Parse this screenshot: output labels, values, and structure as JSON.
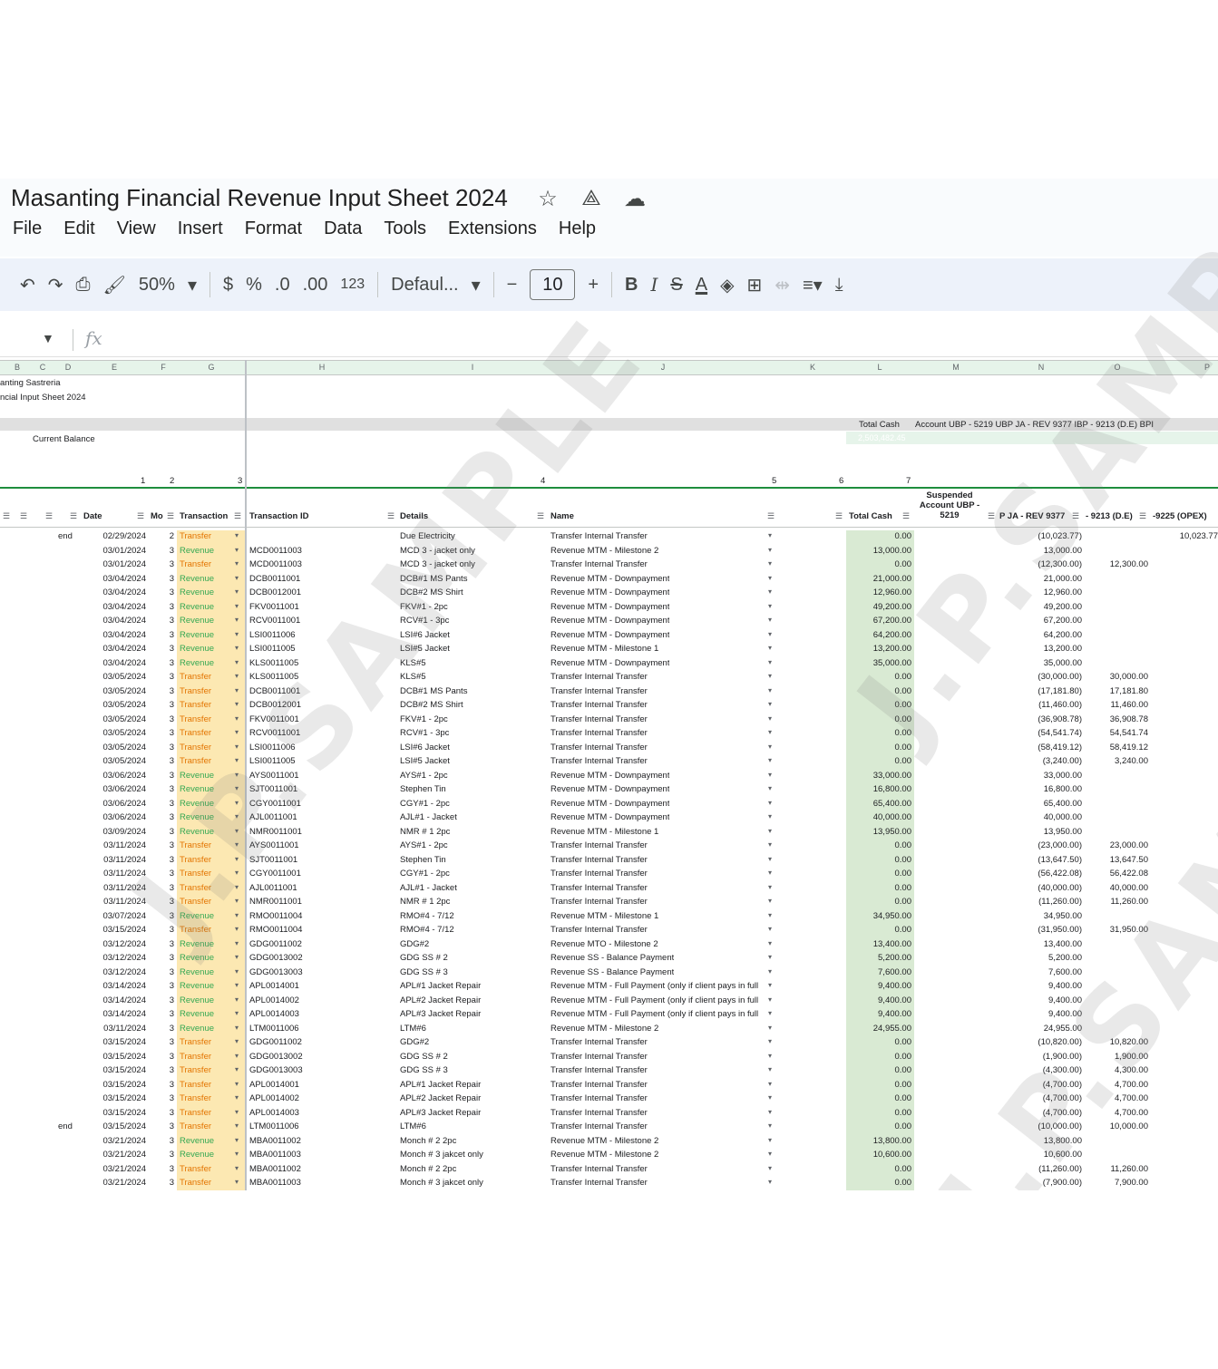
{
  "doc": {
    "title": "Masanting Financial Revenue Input Sheet 2024",
    "menu": [
      "File",
      "Edit",
      "View",
      "Insert",
      "Format",
      "Data",
      "Tools",
      "Extensions",
      "Help"
    ]
  },
  "toolbar": {
    "zoom": "50%",
    "currency": "$",
    "percent": "%",
    "dec_decrease": ".0",
    "dec_increase": ".00",
    "number_format": "123",
    "font": "Defaul...",
    "font_size": "10",
    "minus": "−",
    "plus": "+",
    "bold": "B",
    "italic": "I"
  },
  "formula": {
    "fx": "fx"
  },
  "columns": [
    "B",
    "C",
    "D",
    "E",
    "F",
    "G",
    "H",
    "I",
    "J",
    "K",
    "L",
    "M",
    "N",
    "O",
    "P"
  ],
  "sheet_header": {
    "line1": "anting Sastreria",
    "line2": "ncial Input Sheet 2024",
    "current_balance_label": "Current Balance",
    "total_cash_label": "Total Cash",
    "accounts_line": "Account UBP - 5219  UBP JA - REV 9377 IBP - 9213 (D.E)  BPI",
    "balance_value": "2,503,482.45",
    "group_numbers": [
      "1",
      "2",
      "3",
      "4",
      "5",
      "6",
      "7"
    ]
  },
  "headers": {
    "date": "Date",
    "mo": "Mo",
    "transaction": "Transaction",
    "transaction_id": "Transaction ID",
    "details": "Details",
    "name": "Name",
    "total_cash": "Total Cash",
    "suspended": "Suspended Account UBP - 5219",
    "pja": "P JA - REV 9377",
    "de": "- 9213 (D.E)",
    "opex": "-9225 (OPEX)"
  },
  "rows": [
    {
      "flag": "end",
      "date": "02/29/2024",
      "mo": "2",
      "type": "Transfer",
      "tid": "",
      "details": "Due Electricity",
      "name": "Transfer Internal Transfer",
      "total": "0.00",
      "n": "(10,023.77)",
      "o": "",
      "p": "10,023.77"
    },
    {
      "flag": "",
      "date": "03/01/2024",
      "mo": "3",
      "type": "Revenue",
      "tid": "MCD0011003",
      "details": "MCD 3 - jacket only",
      "name": "Revenue MTM - Milestone 2",
      "total": "13,000.00",
      "n": "13,000.00",
      "o": "",
      "p": ""
    },
    {
      "flag": "",
      "date": "03/01/2024",
      "mo": "3",
      "type": "Transfer",
      "tid": "MCD0011003",
      "details": "MCD 3 - jacket only",
      "name": "Transfer Internal Transfer",
      "total": "0.00",
      "n": "(12,300.00)",
      "o": "12,300.00",
      "p": ""
    },
    {
      "flag": "",
      "date": "03/04/2024",
      "mo": "3",
      "type": "Revenue",
      "tid": "DCB0011001",
      "details": "DCB#1 MS Pants",
      "name": "Revenue MTM - Downpayment",
      "total": "21,000.00",
      "n": "21,000.00",
      "o": "",
      "p": ""
    },
    {
      "flag": "",
      "date": "03/04/2024",
      "mo": "3",
      "type": "Revenue",
      "tid": "DCB0012001",
      "details": "DCB#2 MS Shirt",
      "name": "Revenue MTM - Downpayment",
      "total": "12,960.00",
      "n": "12,960.00",
      "o": "",
      "p": ""
    },
    {
      "flag": "",
      "date": "03/04/2024",
      "mo": "3",
      "type": "Revenue",
      "tid": "FKV0011001",
      "details": "FKV#1 - 2pc",
      "name": "Revenue MTM - Downpayment",
      "total": "49,200.00",
      "n": "49,200.00",
      "o": "",
      "p": ""
    },
    {
      "flag": "",
      "date": "03/04/2024",
      "mo": "3",
      "type": "Revenue",
      "tid": "RCV0011001",
      "details": "RCV#1 - 3pc",
      "name": "Revenue MTM - Downpayment",
      "total": "67,200.00",
      "n": "67,200.00",
      "o": "",
      "p": ""
    },
    {
      "flag": "",
      "date": "03/04/2024",
      "mo": "3",
      "type": "Revenue",
      "tid": "LSI0011006",
      "details": "LSI#6 Jacket",
      "name": "Revenue MTM - Downpayment",
      "total": "64,200.00",
      "n": "64,200.00",
      "o": "",
      "p": ""
    },
    {
      "flag": "",
      "date": "03/04/2024",
      "mo": "3",
      "type": "Revenue",
      "tid": "LSI0011005",
      "details": "LSI#5 Jacket",
      "name": "Revenue MTM - Milestone 1",
      "total": "13,200.00",
      "n": "13,200.00",
      "o": "",
      "p": ""
    },
    {
      "flag": "",
      "date": "03/04/2024",
      "mo": "3",
      "type": "Revenue",
      "tid": "KLS0011005",
      "details": "KLS#5",
      "name": "Revenue MTM - Downpayment",
      "total": "35,000.00",
      "n": "35,000.00",
      "o": "",
      "p": ""
    },
    {
      "flag": "",
      "date": "03/05/2024",
      "mo": "3",
      "type": "Transfer",
      "tid": "KLS0011005",
      "details": "KLS#5",
      "name": "Transfer Internal Transfer",
      "total": "0.00",
      "n": "(30,000.00)",
      "o": "30,000.00",
      "p": ""
    },
    {
      "flag": "",
      "date": "03/05/2024",
      "mo": "3",
      "type": "Transfer",
      "tid": "DCB0011001",
      "details": "DCB#1 MS Pants",
      "name": "Transfer Internal Transfer",
      "total": "0.00",
      "n": "(17,181.80)",
      "o": "17,181.80",
      "p": ""
    },
    {
      "flag": "",
      "date": "03/05/2024",
      "mo": "3",
      "type": "Transfer",
      "tid": "DCB0012001",
      "details": "DCB#2 MS Shirt",
      "name": "Transfer Internal Transfer",
      "total": "0.00",
      "n": "(11,460.00)",
      "o": "11,460.00",
      "p": ""
    },
    {
      "flag": "",
      "date": "03/05/2024",
      "mo": "3",
      "type": "Transfer",
      "tid": "FKV0011001",
      "details": "FKV#1 - 2pc",
      "name": "Transfer Internal Transfer",
      "total": "0.00",
      "n": "(36,908.78)",
      "o": "36,908.78",
      "p": ""
    },
    {
      "flag": "",
      "date": "03/05/2024",
      "mo": "3",
      "type": "Transfer",
      "tid": "RCV0011001",
      "details": "RCV#1 - 3pc",
      "name": "Transfer Internal Transfer",
      "total": "0.00",
      "n": "(54,541.74)",
      "o": "54,541.74",
      "p": ""
    },
    {
      "flag": "",
      "date": "03/05/2024",
      "mo": "3",
      "type": "Transfer",
      "tid": "LSI0011006",
      "details": "LSI#6 Jacket",
      "name": "Transfer Internal Transfer",
      "total": "0.00",
      "n": "(58,419.12)",
      "o": "58,419.12",
      "p": ""
    },
    {
      "flag": "",
      "date": "03/05/2024",
      "mo": "3",
      "type": "Transfer",
      "tid": "LSI0011005",
      "details": "LSI#5 Jacket",
      "name": "Transfer Internal Transfer",
      "total": "0.00",
      "n": "(3,240.00)",
      "o": "3,240.00",
      "p": ""
    },
    {
      "flag": "",
      "date": "03/06/2024",
      "mo": "3",
      "type": "Revenue",
      "tid": "AYS0011001",
      "details": "AYS#1 - 2pc",
      "name": "Revenue MTM - Downpayment",
      "total": "33,000.00",
      "n": "33,000.00",
      "o": "",
      "p": ""
    },
    {
      "flag": "",
      "date": "03/06/2024",
      "mo": "3",
      "type": "Revenue",
      "tid": "SJT0011001",
      "details": "Stephen Tin",
      "name": "Revenue MTM - Downpayment",
      "total": "16,800.00",
      "n": "16,800.00",
      "o": "",
      "p": ""
    },
    {
      "flag": "",
      "date": "03/06/2024",
      "mo": "3",
      "type": "Revenue",
      "tid": "CGY0011001",
      "details": "CGY#1 - 2pc",
      "name": "Revenue MTM - Downpayment",
      "total": "65,400.00",
      "n": "65,400.00",
      "o": "",
      "p": ""
    },
    {
      "flag": "",
      "date": "03/06/2024",
      "mo": "3",
      "type": "Revenue",
      "tid": "AJL0011001",
      "details": "AJL#1 - Jacket",
      "name": "Revenue MTM - Downpayment",
      "total": "40,000.00",
      "n": "40,000.00",
      "o": "",
      "p": ""
    },
    {
      "flag": "",
      "date": "03/09/2024",
      "mo": "3",
      "type": "Revenue",
      "tid": "NMR0011001",
      "details": "NMR # 1 2pc",
      "name": "Revenue MTM - Milestone 1",
      "total": "13,950.00",
      "n": "13,950.00",
      "o": "",
      "p": ""
    },
    {
      "flag": "",
      "date": "03/11/2024",
      "mo": "3",
      "type": "Transfer",
      "tid": "AYS0011001",
      "details": "AYS#1 - 2pc",
      "name": "Transfer Internal Transfer",
      "total": "0.00",
      "n": "(23,000.00)",
      "o": "23,000.00",
      "p": ""
    },
    {
      "flag": "",
      "date": "03/11/2024",
      "mo": "3",
      "type": "Transfer",
      "tid": "SJT0011001",
      "details": "Stephen Tin",
      "name": "Transfer Internal Transfer",
      "total": "0.00",
      "n": "(13,647.50)",
      "o": "13,647.50",
      "p": ""
    },
    {
      "flag": "",
      "date": "03/11/2024",
      "mo": "3",
      "type": "Transfer",
      "tid": "CGY0011001",
      "details": "CGY#1 - 2pc",
      "name": "Transfer Internal Transfer",
      "total": "0.00",
      "n": "(56,422.08)",
      "o": "56,422.08",
      "p": ""
    },
    {
      "flag": "",
      "date": "03/11/2024",
      "mo": "3",
      "type": "Transfer",
      "tid": "AJL0011001",
      "details": "AJL#1 - Jacket",
      "name": "Transfer Internal Transfer",
      "total": "0.00",
      "n": "(40,000.00)",
      "o": "40,000.00",
      "p": ""
    },
    {
      "flag": "",
      "date": "03/11/2024",
      "mo": "3",
      "type": "Transfer",
      "tid": "NMR0011001",
      "details": "NMR # 1 2pc",
      "name": "Transfer Internal Transfer",
      "total": "0.00",
      "n": "(11,260.00)",
      "o": "11,260.00",
      "p": ""
    },
    {
      "flag": "",
      "date": "03/07/2024",
      "mo": "3",
      "type": "Revenue",
      "tid": "RMO0011004",
      "details": "RMO#4 - 7/12",
      "name": "Revenue MTM - Milestone 1",
      "total": "34,950.00",
      "n": "34,950.00",
      "o": "",
      "p": ""
    },
    {
      "flag": "",
      "date": "03/15/2024",
      "mo": "3",
      "type": "Transfer",
      "tid": "RMO0011004",
      "details": "RMO#4 - 7/12",
      "name": "Transfer Internal Transfer",
      "total": "0.00",
      "n": "(31,950.00)",
      "o": "31,950.00",
      "p": ""
    },
    {
      "flag": "",
      "date": "03/12/2024",
      "mo": "3",
      "type": "Revenue",
      "tid": "GDG0011002",
      "details": "GDG#2",
      "name": "Revenue MTO - Milestone 2",
      "total": "13,400.00",
      "n": "13,400.00",
      "o": "",
      "p": ""
    },
    {
      "flag": "",
      "date": "03/12/2024",
      "mo": "3",
      "type": "Revenue",
      "tid": "GDG0013002",
      "details": "GDG SS # 2",
      "name": "Revenue SS - Balance Payment",
      "total": "5,200.00",
      "n": "5,200.00",
      "o": "",
      "p": ""
    },
    {
      "flag": "",
      "date": "03/12/2024",
      "mo": "3",
      "type": "Revenue",
      "tid": "GDG0013003",
      "details": "GDG SS # 3",
      "name": "Revenue SS - Balance Payment",
      "total": "7,600.00",
      "n": "7,600.00",
      "o": "",
      "p": ""
    },
    {
      "flag": "",
      "date": "03/14/2024",
      "mo": "3",
      "type": "Revenue",
      "tid": "APL0014001",
      "details": "APL#1 Jacket Repair",
      "name": "Revenue MTM - Full Payment (only if client pays in full",
      "total": "9,400.00",
      "n": "9,400.00",
      "o": "",
      "p": ""
    },
    {
      "flag": "",
      "date": "03/14/2024",
      "mo": "3",
      "type": "Revenue",
      "tid": "APL0014002",
      "details": "APL#2 Jacket Repair",
      "name": "Revenue MTM - Full Payment (only if client pays in full",
      "total": "9,400.00",
      "n": "9,400.00",
      "o": "",
      "p": ""
    },
    {
      "flag": "",
      "date": "03/14/2024",
      "mo": "3",
      "type": "Revenue",
      "tid": "APL0014003",
      "details": "APL#3 Jacket Repair",
      "name": "Revenue MTM - Full Payment (only if client pays in full",
      "total": "9,400.00",
      "n": "9,400.00",
      "o": "",
      "p": ""
    },
    {
      "flag": "",
      "date": "03/11/2024",
      "mo": "3",
      "type": "Revenue",
      "tid": "LTM0011006",
      "details": "LTM#6",
      "name": "Revenue MTM - Milestone 2",
      "total": "24,955.00",
      "n": "24,955.00",
      "o": "",
      "p": ""
    },
    {
      "flag": "",
      "date": "03/15/2024",
      "mo": "3",
      "type": "Transfer",
      "tid": "GDG0011002",
      "details": "GDG#2",
      "name": "Transfer Internal Transfer",
      "total": "0.00",
      "n": "(10,820.00)",
      "o": "10,820.00",
      "p": ""
    },
    {
      "flag": "",
      "date": "03/15/2024",
      "mo": "3",
      "type": "Transfer",
      "tid": "GDG0013002",
      "details": "GDG SS # 2",
      "name": "Transfer Internal Transfer",
      "total": "0.00",
      "n": "(1,900.00)",
      "o": "1,900.00",
      "p": ""
    },
    {
      "flag": "",
      "date": "03/15/2024",
      "mo": "3",
      "type": "Transfer",
      "tid": "GDG0013003",
      "details": "GDG SS # 3",
      "name": "Transfer Internal Transfer",
      "total": "0.00",
      "n": "(4,300.00)",
      "o": "4,300.00",
      "p": ""
    },
    {
      "flag": "",
      "date": "03/15/2024",
      "mo": "3",
      "type": "Transfer",
      "tid": "APL0014001",
      "details": "APL#1 Jacket Repair",
      "name": "Transfer Internal Transfer",
      "total": "0.00",
      "n": "(4,700.00)",
      "o": "4,700.00",
      "p": ""
    },
    {
      "flag": "",
      "date": "03/15/2024",
      "mo": "3",
      "type": "Transfer",
      "tid": "APL0014002",
      "details": "APL#2 Jacket Repair",
      "name": "Transfer Internal Transfer",
      "total": "0.00",
      "n": "(4,700.00)",
      "o": "4,700.00",
      "p": ""
    },
    {
      "flag": "",
      "date": "03/15/2024",
      "mo": "3",
      "type": "Transfer",
      "tid": "APL0014003",
      "details": "APL#3 Jacket Repair",
      "name": "Transfer Internal Transfer",
      "total": "0.00",
      "n": "(4,700.00)",
      "o": "4,700.00",
      "p": ""
    },
    {
      "flag": "end",
      "date": "03/15/2024",
      "mo": "3",
      "type": "Transfer",
      "tid": "LTM0011006",
      "details": "LTM#6",
      "name": "Transfer Internal Transfer",
      "total": "0.00",
      "n": "(10,000.00)",
      "o": "10,000.00",
      "p": ""
    },
    {
      "flag": "",
      "date": "03/21/2024",
      "mo": "3",
      "type": "Revenue",
      "tid": "MBA0011002",
      "details": "Monch # 2 2pc",
      "name": "Revenue MTM - Milestone 2",
      "total": "13,800.00",
      "n": "13,800.00",
      "o": "",
      "p": ""
    },
    {
      "flag": "",
      "date": "03/21/2024",
      "mo": "3",
      "type": "Revenue",
      "tid": "MBA0011003",
      "details": "Monch # 3 jakcet only",
      "name": "Revenue MTM - Milestone 2",
      "total": "10,600.00",
      "n": "10,600.00",
      "o": "",
      "p": ""
    },
    {
      "flag": "",
      "date": "03/21/2024",
      "mo": "3",
      "type": "Transfer",
      "tid": "MBA0011002",
      "details": "Monch # 2 2pc",
      "name": "Transfer Internal Transfer",
      "total": "0.00",
      "n": "(11,260.00)",
      "o": "11,260.00",
      "p": ""
    },
    {
      "flag": "",
      "date": "03/21/2024",
      "mo": "3",
      "type": "Transfer",
      "tid": "MBA0011003",
      "details": "Monch # 3 jakcet only",
      "name": "Transfer Internal Transfer",
      "total": "0.00",
      "n": "(7,900.00)",
      "o": "7,900.00",
      "p": ""
    }
  ],
  "watermark": "J.P.SAMPLE"
}
